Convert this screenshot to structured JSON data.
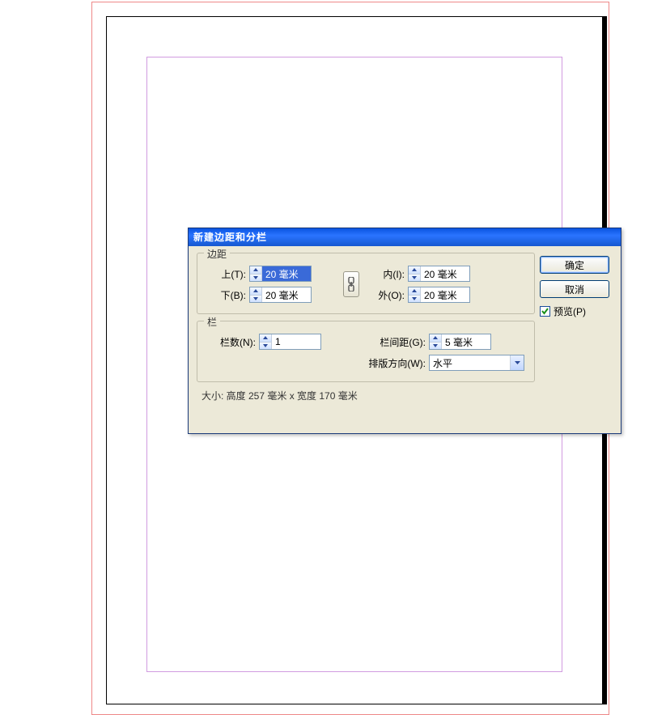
{
  "dialog": {
    "title": "新建边距和分栏",
    "margins": {
      "legend": "边距",
      "top": {
        "label": "上(T):",
        "value": "20 毫米",
        "selected": true
      },
      "bottom": {
        "label": "下(B):",
        "value": "20 毫米",
        "selected": false
      },
      "inside": {
        "label": "内(I):",
        "value": "20 毫米",
        "selected": false
      },
      "outside": {
        "label": "外(O):",
        "value": "20 毫米",
        "selected": false
      }
    },
    "columns": {
      "legend": "栏",
      "count": {
        "label": "栏数(N):",
        "value": "1"
      },
      "gutter": {
        "label": "栏间距(G):",
        "value": "5 毫米"
      },
      "direction": {
        "label": "排版方向(W):",
        "value": "水平"
      }
    },
    "status": "大小: 高度 257 毫米 x 宽度 170 毫米",
    "buttons": {
      "ok": "确定",
      "cancel": "取消"
    },
    "preview": {
      "label": "预览(P)",
      "checked": true
    }
  }
}
